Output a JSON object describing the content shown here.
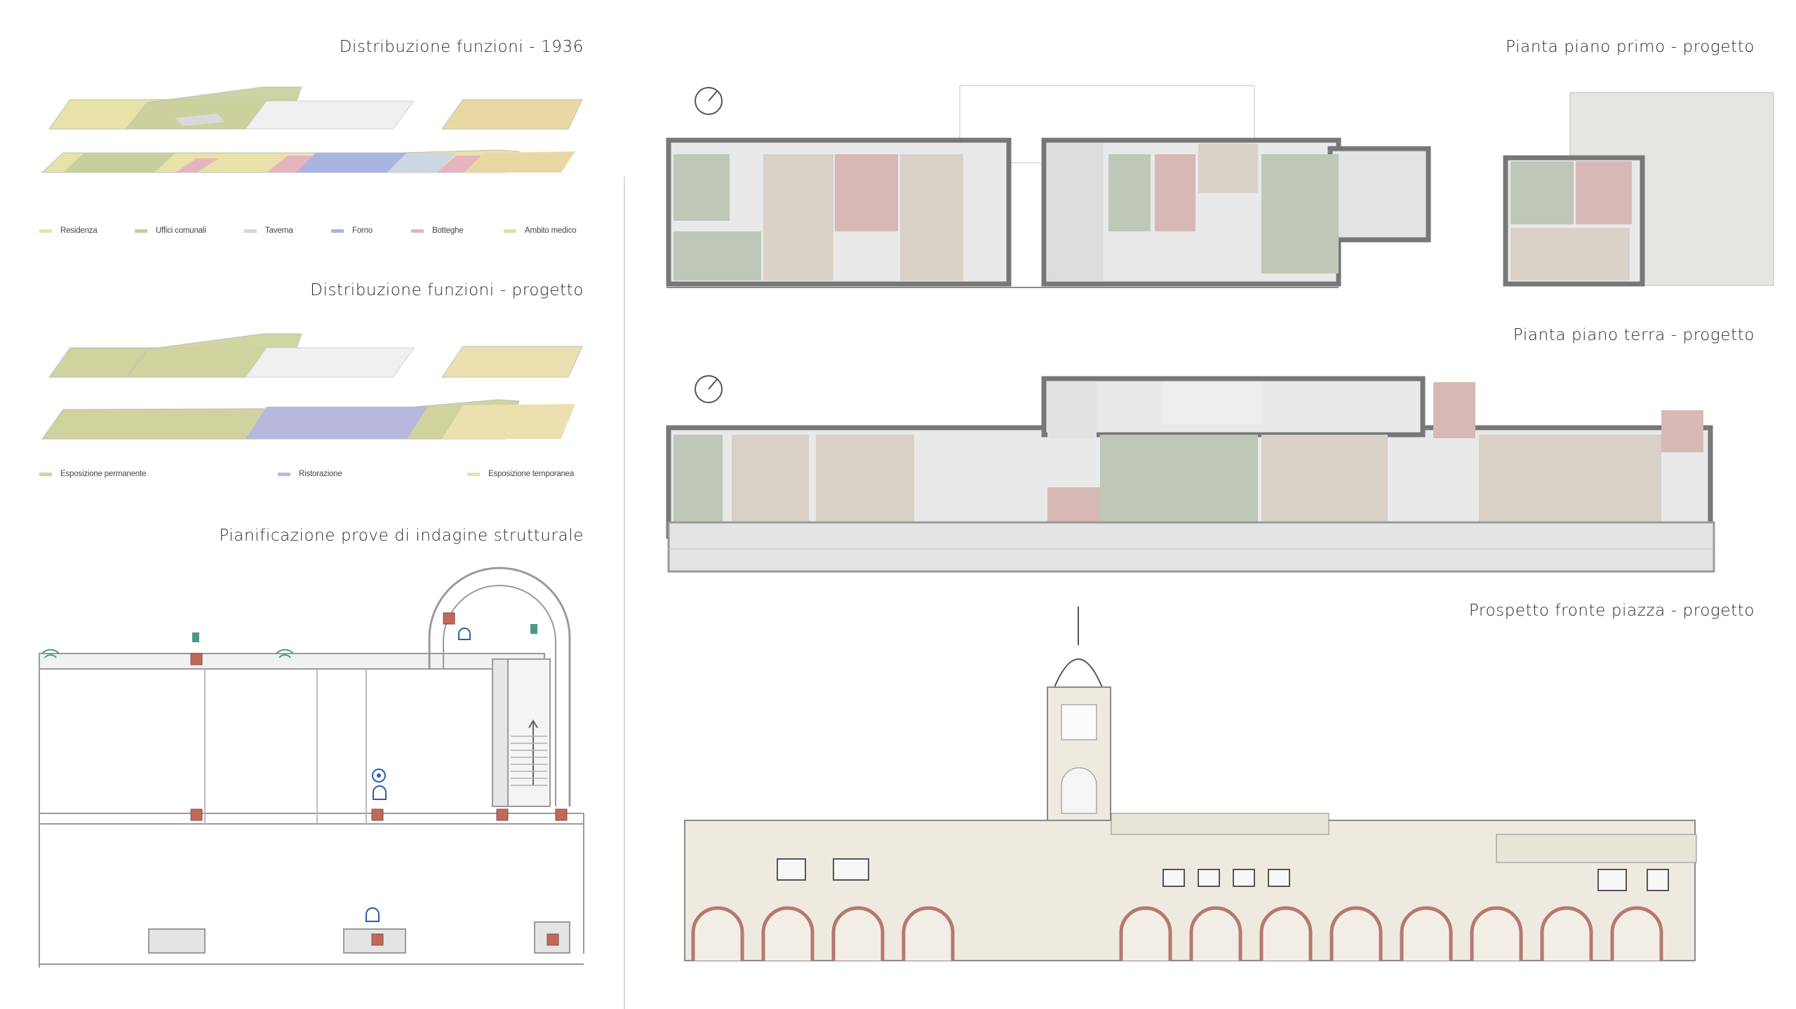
{
  "titles": {
    "distrib_1936": "Distribuzione funzioni - 1936",
    "distrib_progetto": "Distribuzione funzioni - progetto",
    "pianificazione": "Pianificazione prove di indagine strutturale",
    "piano_primo": "Pianta piano primo - progetto",
    "piano_terra": "Pianta piano terra - progetto",
    "prospetto": "Prospetto fronte piazza - progetto"
  },
  "legend_1936": [
    {
      "label": "Residenza",
      "color": "#e6e2a8"
    },
    {
      "label": "Uffici comunali",
      "color": "#c9cf9c"
    },
    {
      "label": "Taverna",
      "color": "#cdd7e3"
    },
    {
      "label": "Forno",
      "color": "#aab4e0"
    },
    {
      "label": "Botteghe",
      "color": "#e6b4be"
    },
    {
      "label": "Ambito medico",
      "color": "#e8d9a4"
    }
  ],
  "legend_progetto": [
    {
      "label": "Esposizione permanente",
      "color": "#cfd39e"
    },
    {
      "label": "Ristorazione",
      "color": "#b8b8dc"
    },
    {
      "label": "Esposizione temporanea",
      "color": "#ece0b0"
    }
  ],
  "colors": {
    "wall": "#7c7c7c",
    "floor_green": "#bfc7b8",
    "floor_pink": "#d8b8b6",
    "floor_grey": "#e2e2e2",
    "facade": "#efeadf",
    "facade_red": "#b5796e"
  },
  "icons": [
    "north-arrow-icon",
    "sensor-wave-icon",
    "hammer-test-icon",
    "core-sample-icon"
  ]
}
